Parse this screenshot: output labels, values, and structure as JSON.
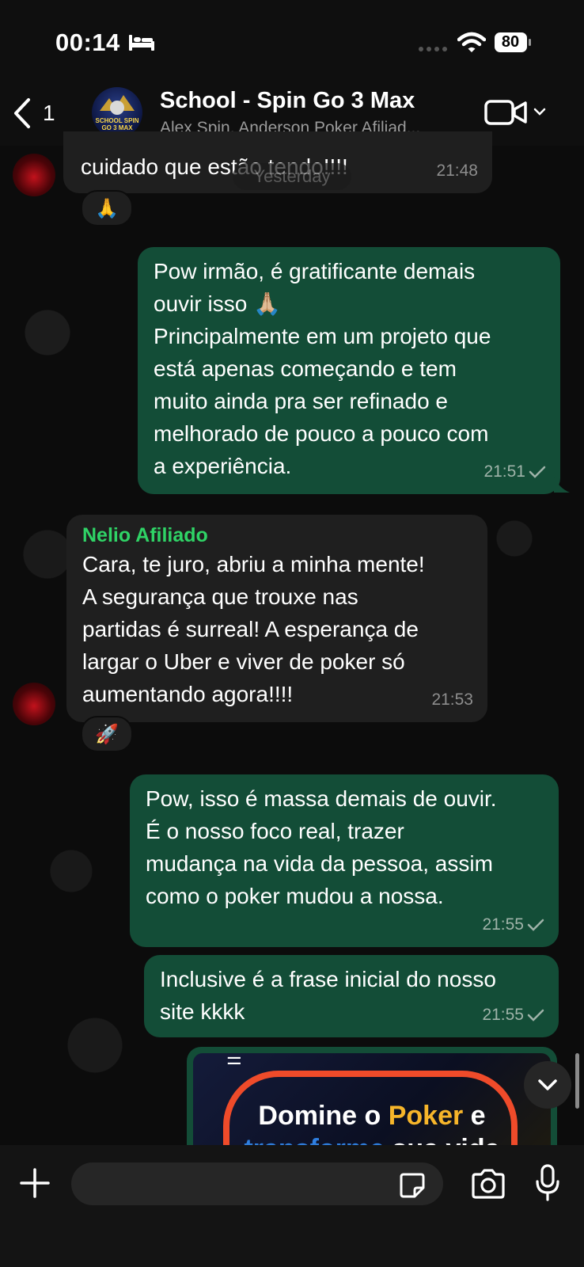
{
  "status_bar": {
    "time": "00:14",
    "battery": "80"
  },
  "header": {
    "back_count": "1",
    "title": "School - Spin Go 3 Max",
    "subtitle": "Alex Spin, Anderson Poker Afiliad...",
    "avatar_text": "SCHOOL SPIN GO 3 MAX"
  },
  "day_separator": "Yesterday",
  "messages": [
    {
      "direction": "in",
      "text": "cuidado que estão tendo!!!!",
      "time": "21:48",
      "reaction": "🙏"
    },
    {
      "direction": "out",
      "text": "Pow irmão, é gratificante demais ouvir isso 🙏🏼 Principalmente em um projeto que está apenas começando e tem muito ainda pra ser refinado e melhorado de pouco a pouco com a experiência.",
      "lines": [
        "Pow irmão, é gratificante demais",
        "ouvir isso 🙏🏼",
        "Principalmente em um projeto que",
        "está apenas começando e tem",
        "muito ainda pra ser refinado e",
        "melhorado de pouco a pouco com",
        "a experiência."
      ],
      "time": "21:51",
      "status": "sent"
    },
    {
      "direction": "in",
      "sender": "Nelio Afiliado",
      "lines": [
        "Cara, te juro, abriu a minha mente!",
        "A segurança que trouxe nas",
        "partidas é surreal! A esperança de",
        "largar o Uber e viver de poker só",
        "aumentando agora!!!!"
      ],
      "time": "21:53",
      "reaction": "🚀"
    },
    {
      "direction": "out",
      "lines": [
        "Pow, isso é massa demais de ouvir.",
        "É o nosso foco real, trazer",
        "mudança na vida da pessoa, assim",
        "como o poker mudou a nossa."
      ],
      "time": "21:55",
      "status": "sent"
    },
    {
      "direction": "out",
      "lines": [
        "Inclusive é a frase inicial do nosso",
        "site kkkk"
      ],
      "time": "21:55",
      "status": "sent"
    },
    {
      "direction": "out",
      "type": "image",
      "headline_a": "Domine o ",
      "headline_b": "Poker",
      "headline_c": " e",
      "sub_a": "transforme",
      "sub_b": " sua vida"
    }
  ],
  "composer": {
    "placeholder": ""
  },
  "colors": {
    "outgoing_bubble": "#134d37",
    "incoming_bubble": "#1f1f1f",
    "sender_name": "#2fd366",
    "background": "#0b0b0b"
  },
  "icons": [
    "bed-icon",
    "wifi-icon",
    "battery-icon",
    "chevron-left-icon",
    "video-camera-icon",
    "chevron-down-icon",
    "check-icon",
    "plus-icon",
    "sticker-icon",
    "camera-icon",
    "microphone-icon"
  ]
}
